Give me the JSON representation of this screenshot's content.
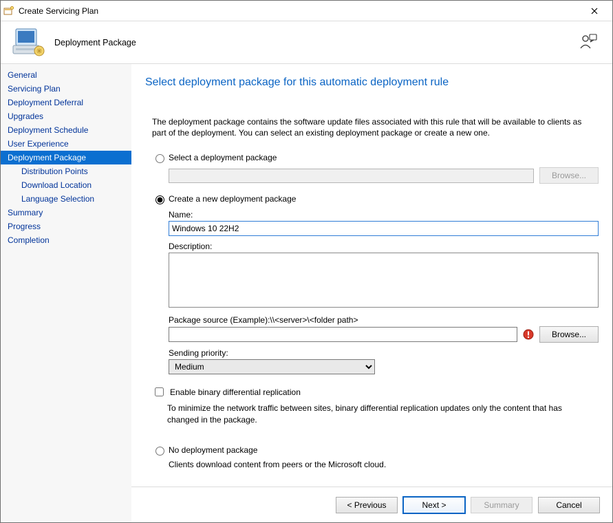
{
  "window": {
    "title": "Create Servicing Plan"
  },
  "header": {
    "page_label": "Deployment Package"
  },
  "sidebar": {
    "items": [
      {
        "label": "General",
        "selected": false,
        "sub": false
      },
      {
        "label": "Servicing Plan",
        "selected": false,
        "sub": false
      },
      {
        "label": "Deployment Deferral",
        "selected": false,
        "sub": false
      },
      {
        "label": "Upgrades",
        "selected": false,
        "sub": false
      },
      {
        "label": "Deployment Schedule",
        "selected": false,
        "sub": false
      },
      {
        "label": "User Experience",
        "selected": false,
        "sub": false
      },
      {
        "label": "Deployment Package",
        "selected": true,
        "sub": false
      },
      {
        "label": "Distribution Points",
        "selected": false,
        "sub": true
      },
      {
        "label": "Download Location",
        "selected": false,
        "sub": true
      },
      {
        "label": "Language Selection",
        "selected": false,
        "sub": true
      },
      {
        "label": "Summary",
        "selected": false,
        "sub": false
      },
      {
        "label": "Progress",
        "selected": false,
        "sub": false
      },
      {
        "label": "Completion",
        "selected": false,
        "sub": false
      }
    ]
  },
  "main": {
    "heading": "Select deployment package for this automatic deployment rule",
    "intro": "The deployment package contains the software update files associated with this rule that will be available to clients as part of the deployment. You can select an existing deployment package or create a new one.",
    "option_select_label": "Select a deployment package",
    "browse_disabled_label": "Browse...",
    "option_create_label": "Create a new deployment package",
    "name_label": "Name:",
    "name_value": "Windows 10 22H2",
    "description_label": "Description:",
    "description_value": "",
    "source_label": "Package source (Example):\\\\<server>\\<folder path>",
    "source_value": "",
    "browse_label": "Browse...",
    "priority_label": "Sending priority:",
    "priority_value": "Medium",
    "binary_diff_label": "Enable binary differential replication",
    "binary_diff_hint": "To minimize the network traffic between sites, binary differential replication updates only the content that has changed in the package.",
    "option_none_label": "No deployment package",
    "option_none_hint": "Clients download content from peers or the Microsoft cloud."
  },
  "footer": {
    "previous": "< Previous",
    "next": "Next >",
    "summary": "Summary",
    "cancel": "Cancel"
  }
}
